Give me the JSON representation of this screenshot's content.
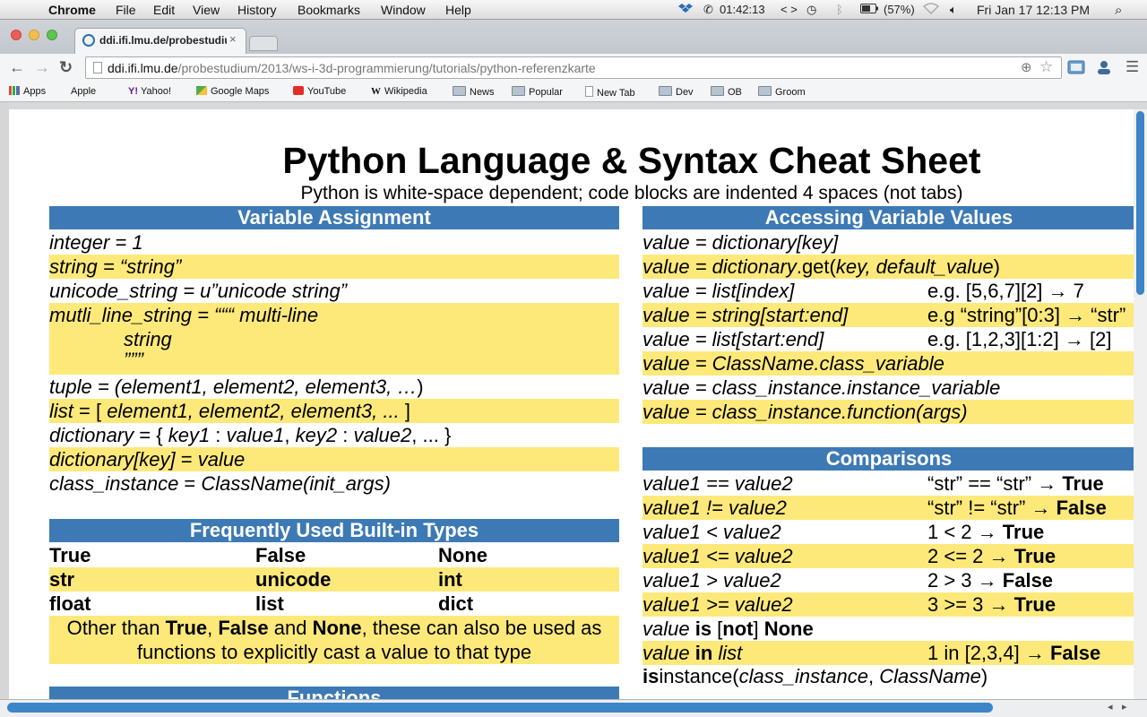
{
  "menubar": {
    "apple_glyph": "",
    "items": [
      "Chrome",
      "File",
      "Edit",
      "View",
      "History",
      "Bookmarks",
      "Window",
      "Help"
    ],
    "status": {
      "timer": "01:42:13",
      "arrows": "< >",
      "battery": "(57%)",
      "datetime": "Fri Jan 17  12:13 PM"
    }
  },
  "tab": {
    "title": "ddi.ifi.lmu.de/probestudiu",
    "close": "×"
  },
  "toolbar": {
    "back": "←",
    "forward": "→",
    "reload": "↻",
    "url_host": "ddi.ifi.lmu.de",
    "url_path": "/probestudium/2013/ws-i-3d-programmierung/tutorials/python-referenzkarte",
    "zoom": "⊕",
    "star": "☆"
  },
  "bookmarks": [
    "Apps",
    "Apple",
    "Yahoo!",
    "Google Maps",
    "YouTube",
    "Wikipedia",
    "News",
    "Popular",
    "New Tab",
    "Dev",
    "OB",
    "Groom"
  ],
  "sheet": {
    "title": "Python Language & Syntax Cheat Sheet",
    "subtitle": "Python is white-space dependent; code blocks are indented 4 spaces (not tabs)",
    "var_header": "Variable Assignment",
    "var": {
      "r1": "integer = 1",
      "r2": "string = “string”",
      "r3": "unicode_string = u”unicode string”",
      "r4a": "mutli_line_string = “““ multi-line",
      "r4b": "string",
      "r4c": "”””",
      "r5a": "tuple = (",
      "r5b": "element1, element2, element3, …",
      "r5c": ")",
      "r6a": "list",
      "r6b": " = [ ",
      "r6c": "element1, element2, element3, ...",
      "r6d": " ]",
      "r7a": "dictionary",
      "r7b": " =  { ",
      "r7c": "key1",
      "r7d": " : ",
      "r7e": "value1",
      "r7f": ", ",
      "r7g": "key2",
      "r7h": " : ",
      "r7i": "value2",
      "r7j": ", ... }",
      "r8a": "dictionary[key]",
      "r8b": " = ",
      "r8c": "value",
      "r9a": "class_instance",
      "r9b": " = ",
      "r9c": "ClassName(init_args)"
    },
    "types_header": "Frequently Used Built-in Types",
    "types": [
      [
        "True",
        "False",
        "None"
      ],
      [
        "str",
        "unicode",
        "int"
      ],
      [
        "float",
        "list",
        "dict"
      ]
    ],
    "types_note": {
      "a": "Other than ",
      "b": "True",
      ",": ", ",
      "c": "False",
      "d": " and ",
      "e": "None",
      "f": ", these can also be used as",
      "g": "functions to explicitly cast a value to that type"
    },
    "functions_header": "Functions",
    "access_header": "Accessing Variable Values",
    "access": {
      "a1": "value = dictionary[key]",
      "a2a": "value = dictionary",
      "a2b": ".get(",
      "a2c": "key, default_value",
      "a2d": ")",
      "a3a": "value = list[index]",
      "a3b": "e.g.  [5,6,7][2] → 7",
      "a4a": "value = string[start:end]",
      "a4b": "e.g “string”[0:3] → “str”",
      "a5a": "value = list[start:end]",
      "a5b": "e.g. [1,2,3][1:2] → [2]",
      "a6": "value = ClassName.class_variable",
      "a7": "value = class_instance.instance_variable",
      "a8": "value = class_instance.function(args)"
    },
    "comp_header": "Comparisons",
    "comp": [
      {
        "l": "value1 == value2",
        "r1": "“str” == “str” → ",
        "r2": "True"
      },
      {
        "l": "value1 != value2",
        "r1": "“str” != “str” → ",
        "r2": "False"
      },
      {
        "l": "value1 < value2",
        "r1": "1 < 2 → ",
        "r2": "True"
      },
      {
        "l": "value1 <= value2",
        "r1": "2 <= 2 → ",
        "r2": "True"
      },
      {
        "l": "value1 > value2",
        "r1": "2 > 3 → ",
        "r2": "False"
      },
      {
        "l": "value1 >= value2",
        "r1": "3 >= 3 → ",
        "r2": "True"
      }
    ],
    "comp_is": {
      "a": "value",
      "b": " is ",
      "c": "[",
      "d": "not",
      "e": "] ",
      "f": "None"
    },
    "comp_in": {
      "a": "value",
      "b": " in ",
      "c": "list",
      "r1": "1 in [2,3,4] → ",
      "r2": "False"
    },
    "comp_isinst": {
      "a": "is",
      "b": "instance(",
      "c": "class_instance",
      "d": ", ",
      "e": "ClassName",
      "f": ")"
    }
  }
}
